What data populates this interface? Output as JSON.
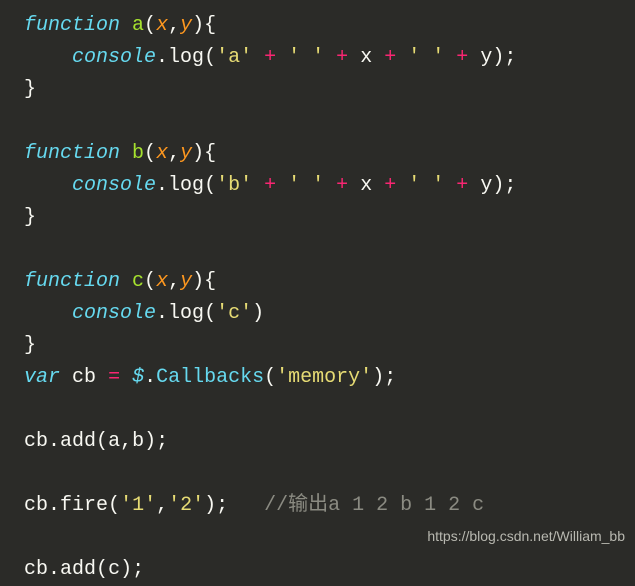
{
  "code": {
    "kw_function1": "function",
    "fn_a": "a",
    "p_x1": "x",
    "p_y1": "y",
    "console1": "console",
    "log1": "log",
    "str_a": "'a'",
    "str_sp1": "' '",
    "str_sp2": "' '",
    "vx1": "x",
    "vy1": "y",
    "kw_function2": "function",
    "fn_b": "b",
    "p_x2": "x",
    "p_y2": "y",
    "console2": "console",
    "log2": "log",
    "str_b": "'b'",
    "str_sp3": "' '",
    "str_sp4": "' '",
    "vx2": "x",
    "vy2": "y",
    "kw_function3": "function",
    "fn_c": "c",
    "p_x3": "x",
    "p_y3": "y",
    "console3": "console",
    "log3": "log",
    "str_c": "'c'",
    "kw_var": "var",
    "v_cb": "cb",
    "dollar": "$",
    "callbacks": "Callbacks",
    "str_memory": "'memory'",
    "cb1": "cb",
    "add1": "add",
    "arg_a": "a",
    "arg_b": "b",
    "cb2": "cb",
    "fire": "fire",
    "str_1": "'1'",
    "str_2": "'2'",
    "comment": "//输出a 1 2 b 1 2 c",
    "cb3": "cb",
    "add2": "add",
    "arg_c": "c"
  },
  "watermark": "https://blog.csdn.net/William_bb"
}
